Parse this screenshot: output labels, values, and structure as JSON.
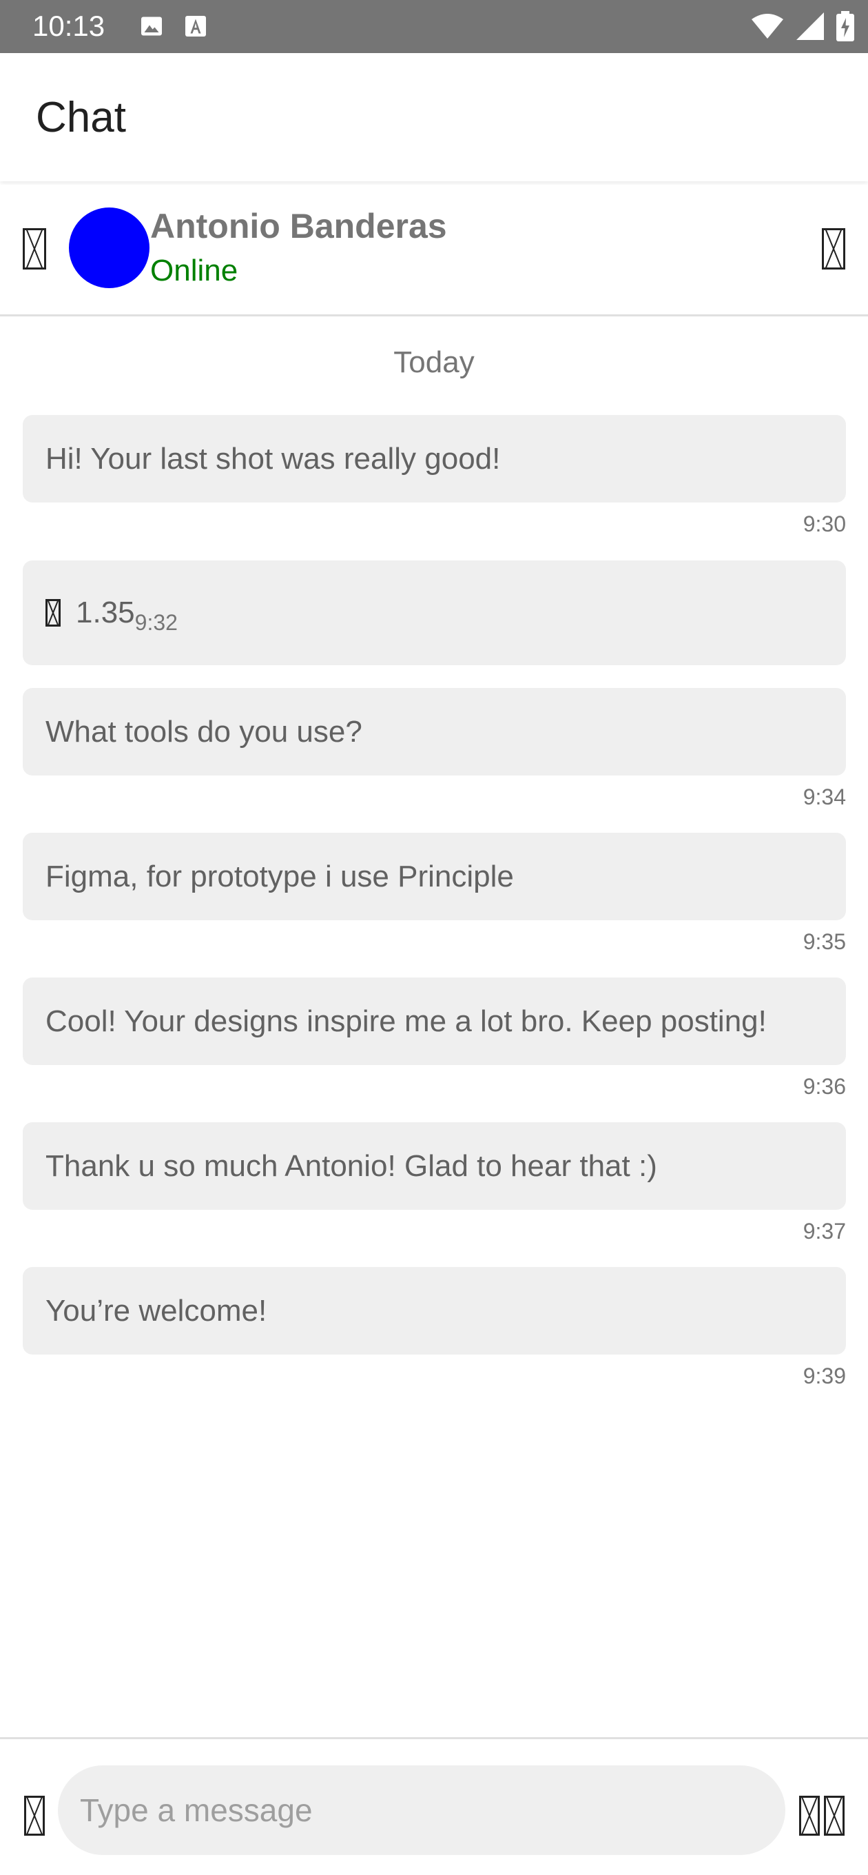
{
  "status_bar": {
    "time": "10:13",
    "left_icons": [
      "image-icon",
      "font-a-icon"
    ],
    "right_icons": [
      "wifi-icon",
      "signal-icon",
      "battery-charging-icon"
    ]
  },
  "app_bar": {
    "title": "Chat"
  },
  "chat_header": {
    "back_icon": "back-arrow-icon",
    "name": "Antonio Banderas",
    "status": "Online",
    "status_color": "#008000",
    "avatar_color": "#0000ff",
    "more_icon": "more-icon"
  },
  "date_divider": "Today",
  "messages": [
    {
      "text": "Hi! Your last shot was really good!",
      "time": "9:30"
    },
    {
      "icon": "play-icon",
      "value": "1.35",
      "time": "9:32"
    },
    {
      "text": "What tools do you use?",
      "time": "9:34"
    },
    {
      "text": "Figma, for prototype i use Principle",
      "time": "9:35"
    },
    {
      "text": "Cool! Your designs inspire me a lot bro. Keep posting!",
      "time": "9:36"
    },
    {
      "text": "Thank u so much Antonio! Glad to hear that :)",
      "time": "9:37"
    },
    {
      "text": "You’re welcome!",
      "time": "9:39"
    }
  ],
  "composer": {
    "placeholder": "Type a message",
    "left_icon": "emoji-icon",
    "right_icons": [
      "attach-icon",
      "send-icon"
    ]
  }
}
